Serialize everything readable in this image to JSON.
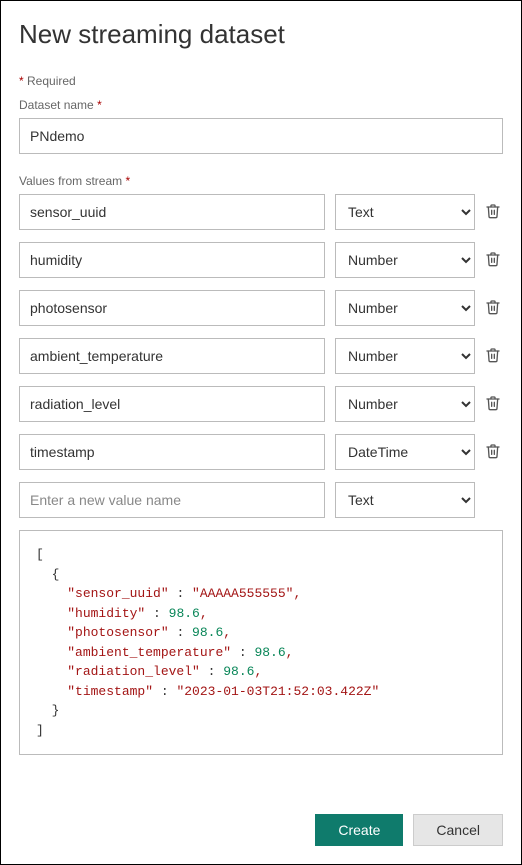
{
  "title": "New streaming dataset",
  "required_note": "Required",
  "labels": {
    "dataset_name": "Dataset name",
    "values_from_stream": "Values from stream"
  },
  "dataset_name_value": "PNdemo",
  "type_options": [
    "Text",
    "Number",
    "DateTime"
  ],
  "stream_values": [
    {
      "name": "sensor_uuid",
      "type": "Text"
    },
    {
      "name": "humidity",
      "type": "Number"
    },
    {
      "name": "photosensor",
      "type": "Number"
    },
    {
      "name": "ambient_temperature",
      "type": "Number"
    },
    {
      "name": "radiation_level",
      "type": "Number"
    },
    {
      "name": "timestamp",
      "type": "DateTime"
    }
  ],
  "new_value": {
    "placeholder": "Enter a new value name",
    "type": "Text"
  },
  "sample_json": {
    "sensor_uuid": "AAAAA555555",
    "humidity": 98.6,
    "photosensor": 98.6,
    "ambient_temperature": 98.6,
    "radiation_level": 98.6,
    "timestamp": "2023-01-03T21:52:03.422Z"
  },
  "buttons": {
    "create": "Create",
    "cancel": "Cancel"
  },
  "colors": {
    "primary": "#0f7b6c",
    "required": "#a80000"
  }
}
